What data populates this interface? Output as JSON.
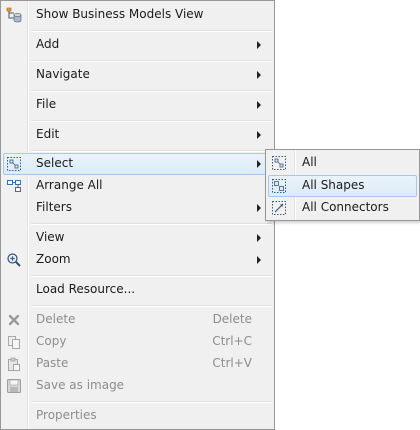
{
  "menu": {
    "show_business_models": "Show Business Models View",
    "add": "Add",
    "navigate": "Navigate",
    "file": "File",
    "edit": "Edit",
    "select": "Select",
    "arrange_all": "Arrange All",
    "filters": "Filters",
    "view": "View",
    "zoom": "Zoom",
    "load_resource": "Load Resource...",
    "delete": "Delete",
    "delete_shortcut": "Delete",
    "copy": "Copy",
    "copy_shortcut": "Ctrl+C",
    "paste": "Paste",
    "paste_shortcut": "Ctrl+V",
    "save_as_image": "Save as image",
    "properties": "Properties"
  },
  "submenu": {
    "all": "All",
    "all_shapes": "All Shapes",
    "all_connectors": "All Connectors"
  },
  "colors": {
    "menu_bg": "#f0f0f0",
    "highlight_border": "#a8c8e5",
    "highlight_fill": "#dcebf7",
    "disabled_text": "#8d8d8d"
  }
}
